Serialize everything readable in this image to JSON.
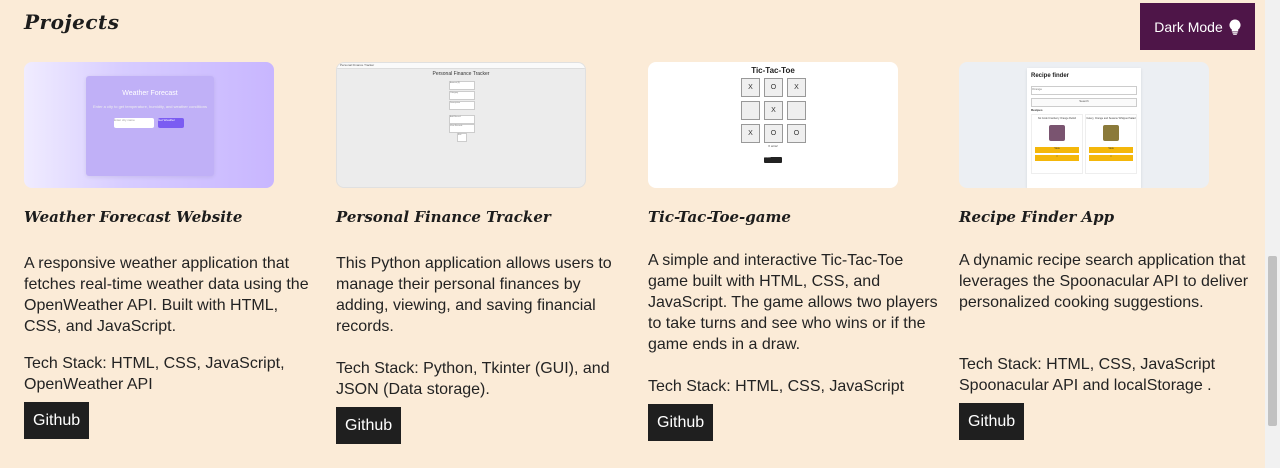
{
  "header": {
    "title": "Projects",
    "dark_mode_label": "Dark Mode",
    "dark_mode_icon": "lightbulb-icon",
    "accent_color": "#4e1548"
  },
  "projects": [
    {
      "title": "Weather Forecast Website",
      "description": "A responsive weather application that fetches real-time weather data using the OpenWeather API. Built with HTML, CSS, and JavaScript.",
      "tech_stack": "Tech Stack: HTML, CSS, JavaScript, OpenWeather API",
      "github_label": "Github",
      "thumbnail": {
        "heading": "Weather Forecast",
        "subtext": "Enter a city to get temperature, humidity, and weather conditions",
        "input_placeholder": "Enter city name",
        "button_label": "Get Weather"
      }
    },
    {
      "title": "Personal Finance Tracker",
      "description": "This Python application allows users to manage their personal finances by adding, viewing, and saving financial records.",
      "tech_stack": "Tech Stack: Python, Tkinter (GUI), and JSON (Data storage).",
      "github_label": "Github",
      "thumbnail": {
        "window_title": "Personal Finance Tracker",
        "heading": "Personal Finance Tracker",
        "fields": [
          "Amount ($)",
          "Category",
          "Description",
          "Add Record",
          "View Records",
          "Exit"
        ]
      }
    },
    {
      "title": "Tic-Tac-Toe-game",
      "description": "A simple and interactive Tic-Tac-Toe game built with HTML, CSS, and JavaScript. The game allows two players to take turns and see who wins or if the game ends in a draw.",
      "tech_stack": "Tech Stack: HTML, CSS, JavaScript",
      "github_label": "Github",
      "thumbnail": {
        "heading": "Tic-Tac-Toe",
        "cells": [
          "X",
          "O",
          "X",
          "",
          "X",
          "",
          "X",
          "O",
          "O"
        ],
        "winner_text": "X wins!",
        "reset_label": "Restart"
      }
    },
    {
      "title": "Recipe Finder App",
      "description": "A dynamic recipe search application that leverages the Spoonacular API to deliver personalized cooking suggestions.",
      "tech_stack": "Tech Stack: HTML, CSS, JavaScript Spoonacular API and localStorage .",
      "github_label": "Github",
      "thumbnail": {
        "heading": "Recipe finder",
        "input_value": "Orange",
        "search_label": "Search",
        "recipes_label": "Recipes",
        "recipe_1": "No Cook Cranberry Orange Relish",
        "recipe_2": "Celery, Orange and Sesame Whipped Salad",
        "view_label": "View",
        "save_label": "☆"
      }
    }
  ]
}
